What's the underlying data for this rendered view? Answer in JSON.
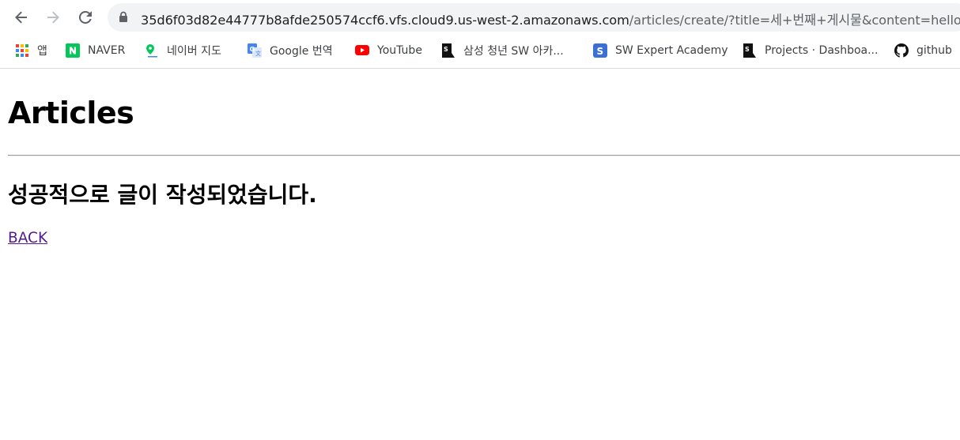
{
  "browser": {
    "url_host": "35d6f03d82e44777b8afde250574ccf6.vfs.cloud9.us-west-2.amazonaws.com",
    "url_path": "/articles/create/?title=세+번째+게시물&content=hello",
    "bookmarks": [
      {
        "label": "앱",
        "icon": "apps-grid-icon"
      },
      {
        "label": "NAVER",
        "icon": "naver-icon",
        "color": "#03c75a"
      },
      {
        "label": "네이버 지도",
        "icon": "map-pin-icon",
        "color": "#03c75a"
      },
      {
        "label": "Google 번역",
        "icon": "google-translate-icon",
        "color": "#4285f4"
      },
      {
        "label": "YouTube",
        "icon": "youtube-icon",
        "color": "#ff0000"
      },
      {
        "label": "삼성 청년 SW 아카...",
        "icon": "ssafy-icon"
      },
      {
        "label": "SW Expert Academy",
        "icon": "swea-icon",
        "color": "#3b6fd4"
      },
      {
        "label": "Projects · Dashboa...",
        "icon": "ssafy-icon"
      },
      {
        "label": "github",
        "icon": "github-icon"
      }
    ]
  },
  "page": {
    "title": "Articles",
    "message": "성공적으로 글이 작성되었습니다.",
    "back_link": "BACK"
  },
  "colors": {
    "link_visited": "#551a8b",
    "omnibox_bg": "#f1f3f4"
  }
}
